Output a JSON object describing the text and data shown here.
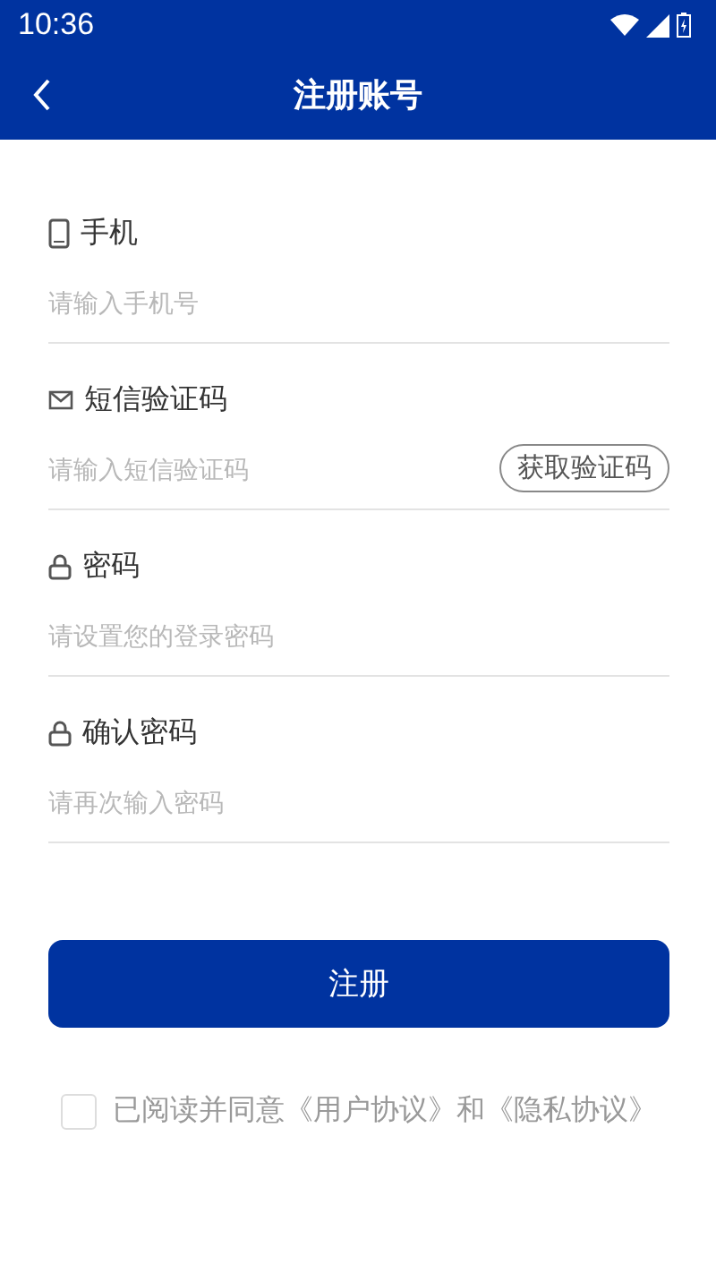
{
  "status_bar": {
    "time": "10:36"
  },
  "header": {
    "title": "注册账号"
  },
  "fields": [
    {
      "kind": "phone",
      "label": "手机",
      "placeholder": "请输入手机号"
    },
    {
      "kind": "sms",
      "label": "短信验证码",
      "placeholder": "请输入短信验证码",
      "action": "获取验证码"
    },
    {
      "kind": "lock",
      "label": "密码",
      "placeholder": "请设置您的登录密码"
    },
    {
      "kind": "lock",
      "label": "确认密码",
      "placeholder": "请再次输入密码"
    }
  ],
  "submit": "注册",
  "agreement": {
    "checked": false,
    "text": "已阅读并同意《用户协议》和《隐私协议》"
  }
}
